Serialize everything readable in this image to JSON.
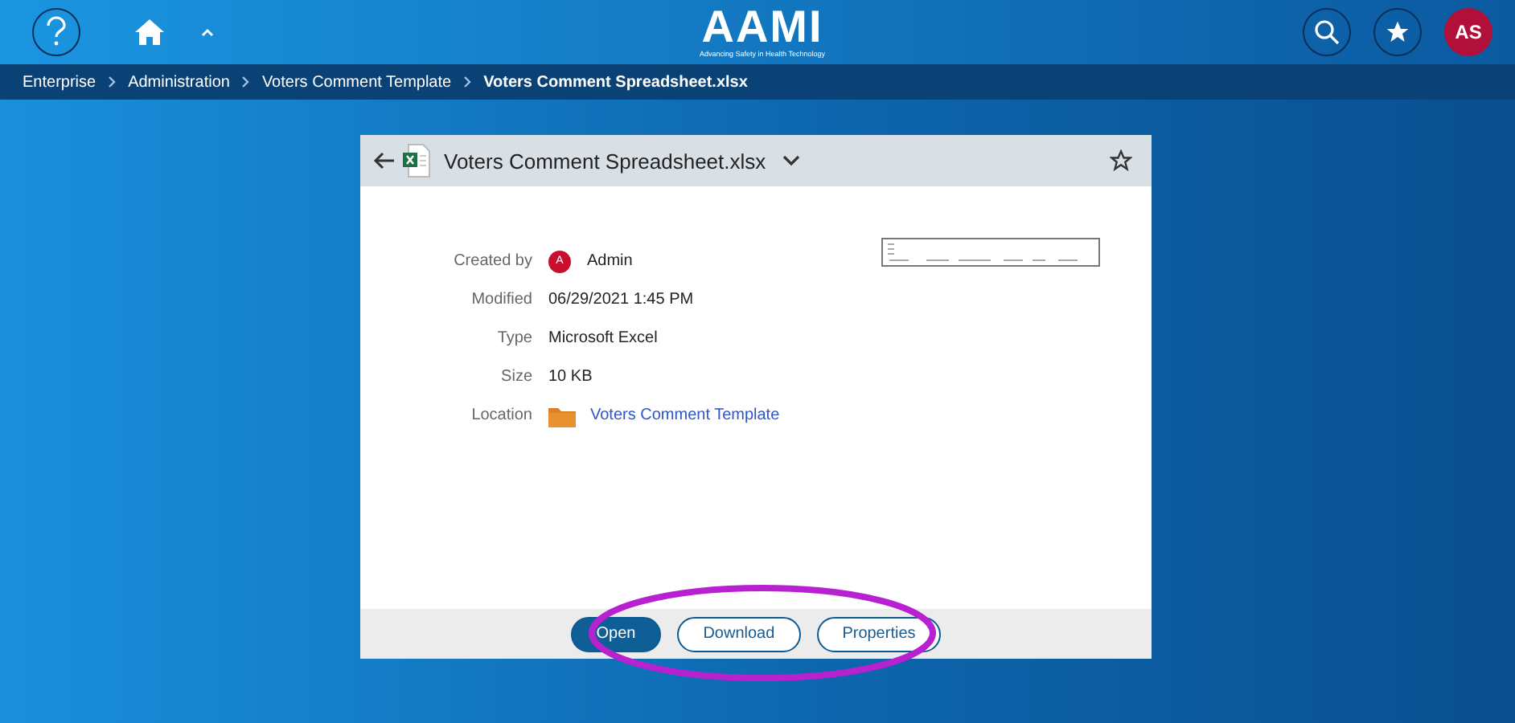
{
  "header": {
    "logo": "AAMI",
    "tagline": "Advancing Safety in Health Technology",
    "avatar": "AS"
  },
  "breadcrumb": [
    {
      "label": "Enterprise",
      "current": false
    },
    {
      "label": "Administration",
      "current": false
    },
    {
      "label": "Voters Comment Template",
      "current": false
    },
    {
      "label": "Voters Comment Spreadsheet.xlsx",
      "current": true
    }
  ],
  "card": {
    "title": "Voters Comment Spreadsheet.xlsx",
    "details": [
      {
        "label": "Created by",
        "value": "Admin",
        "kind": "user",
        "avatar": "A"
      },
      {
        "label": "Modified",
        "value": "06/29/2021 1:45 PM",
        "kind": "text"
      },
      {
        "label": "Type",
        "value": "Microsoft Excel",
        "kind": "text"
      },
      {
        "label": "Size",
        "value": "10 KB",
        "kind": "text"
      },
      {
        "label": "Location",
        "value": "Voters Comment Template",
        "kind": "folder"
      }
    ],
    "buttons": [
      {
        "label": "Open",
        "primary": true
      },
      {
        "label": "Download",
        "primary": false
      },
      {
        "label": "Properties",
        "primary": false
      }
    ]
  }
}
